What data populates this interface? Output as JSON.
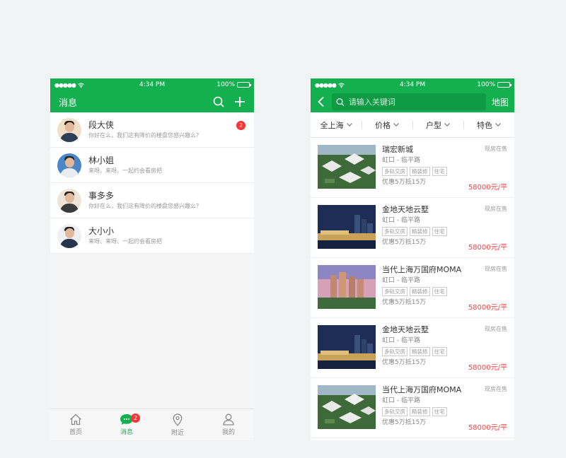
{
  "status": {
    "time": "4:34 PM",
    "battery": "100%"
  },
  "left": {
    "title": "消息",
    "messages": [
      {
        "name": "段大侠",
        "preview": "你好在么，我们这有降价的楼盘您感兴趣么?",
        "badge": "2"
      },
      {
        "name": "林小姐",
        "preview": "来呀、来呀、一起约会看房把",
        "badge": ""
      },
      {
        "name": "事多多",
        "preview": "你好在么，我们这有降价的楼盘您感兴趣么?",
        "badge": ""
      },
      {
        "name": "大小小",
        "preview": "来呀、来呀、一起约会看房把",
        "badge": ""
      }
    ],
    "tabs": [
      {
        "label": "首页",
        "icon": "home-icon"
      },
      {
        "label": "消息",
        "icon": "chat-icon",
        "badge": "2"
      },
      {
        "label": "附近",
        "icon": "location-pin-icon"
      },
      {
        "label": "我的",
        "icon": "user-icon"
      }
    ]
  },
  "right": {
    "search_placeholder": "请输入关键词",
    "map_label": "地图",
    "filters": [
      "全上海",
      "价格",
      "户型",
      "特色"
    ],
    "listings": [
      {
        "name": "瑞宏新城",
        "location": "虹口 - 临平路",
        "tags": [
          "多轨交房",
          "精装修",
          "住宅"
        ],
        "promo": "优惠5万抵15万",
        "status": "现房在售",
        "price": "58000",
        "unit": "元/平",
        "image": "villa-aerial"
      },
      {
        "name": "金地天地云墅",
        "location": "虹口 - 临平路",
        "tags": [
          "多轨交房",
          "精装修",
          "住宅"
        ],
        "promo": "优惠5万抵15万",
        "status": "现房在售",
        "price": "58000",
        "unit": "元/平",
        "image": "city-night"
      },
      {
        "name": "当代上海万国府MOMA",
        "location": "虹口 - 临平路",
        "tags": [
          "多轨交房",
          "精装修",
          "住宅"
        ],
        "promo": "优惠5万抵15万",
        "status": "现房在售",
        "price": "58000",
        "unit": "元/平",
        "image": "towers-sunset"
      },
      {
        "name": "金地天地云墅",
        "location": "虹口 - 临平路",
        "tags": [
          "多轨交房",
          "精装修",
          "住宅"
        ],
        "promo": "优惠5万抵15万",
        "status": "现房在售",
        "price": "58000",
        "unit": "元/平",
        "image": "city-night"
      },
      {
        "name": "当代上海万国府MOMA",
        "location": "虹口 - 临平路",
        "tags": [
          "多轨交房",
          "精装修",
          "住宅"
        ],
        "promo": "优惠5万抵15万",
        "status": "现房在售",
        "price": "58000",
        "unit": "元/平",
        "image": "villa-aerial"
      }
    ]
  },
  "colors": {
    "brand": "#14b04f",
    "price": "#f44444",
    "badge": "#ff3333"
  }
}
